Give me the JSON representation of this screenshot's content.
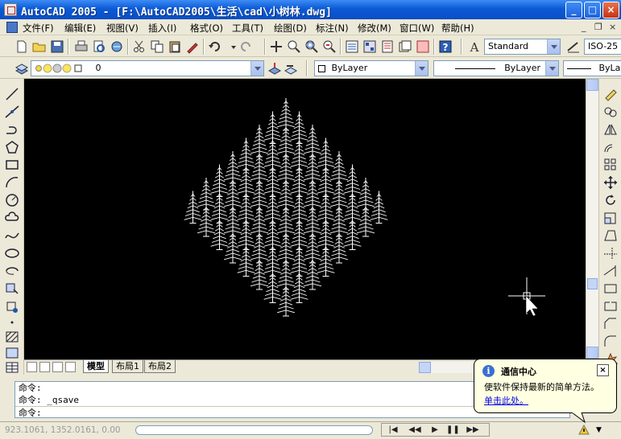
{
  "window": {
    "title": "AutoCAD 2005 - [F:\\AutoCAD2005\\生活\\cad\\小树林.dwg]",
    "controls": {
      "minimize": "_",
      "maximize": "□",
      "close": "×"
    }
  },
  "menubar": {
    "items": [
      "文件(F)",
      "编辑(E)",
      "视图(V)",
      "插入(I)",
      "格式(O)",
      "工具(T)",
      "绘图(D)",
      "标注(N)",
      "修改(M)",
      "窗口(W)",
      "帮助(H)"
    ],
    "doc_controls": {
      "minimize": "_",
      "restore": "❐",
      "close": "×"
    }
  },
  "standard_toolbar": {
    "text_style": "Standard",
    "dim_style": "ISO-25"
  },
  "layers_toolbar": {
    "layer": "0",
    "color": "ByLayer",
    "linetype": "ByLayer",
    "lineweight": "ByLay"
  },
  "layout_tabs": [
    "模型",
    "布局1",
    "布局2"
  ],
  "command_line": {
    "lines": [
      "命令:",
      "命令: _qsave",
      "命令:"
    ]
  },
  "status": {
    "coords": "923.1061, 1352.0161, 0.00",
    "play_buttons": [
      "|◀",
      "◀◀",
      "▶",
      "❚❚",
      "▶▶"
    ]
  },
  "balloon": {
    "title": "通信中心",
    "message": "使软件保持最新的简单方法。",
    "link": "单击此处。",
    "close": "×"
  },
  "colors": {
    "titlebar": "#0b5ad6",
    "canvas": "#000000",
    "tree": "#ffffff",
    "balloon": "#ffffe1"
  }
}
